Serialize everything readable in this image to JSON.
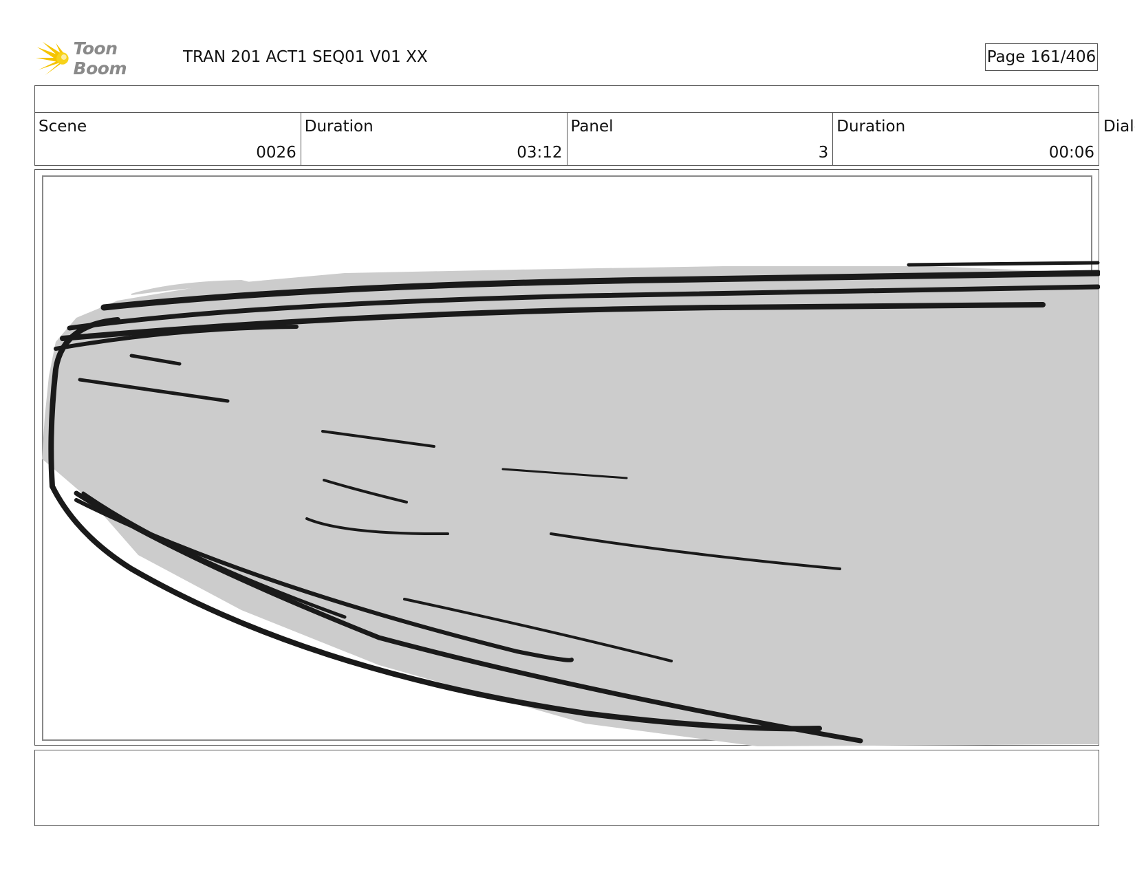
{
  "header": {
    "logo_text": "Toon Boom",
    "title": "TRAN 201 ACT1 SEQ01 V01 XX",
    "page": "Page 161/406"
  },
  "info": {
    "scene_label": "Scene",
    "scene_value": "0026",
    "scene_duration_label": "Duration",
    "scene_duration_value": "03:12",
    "panel_label": "Panel",
    "panel_value": "3",
    "panel_duration_label": "Duration",
    "panel_duration_value": "00:06",
    "dialog_label": "Dialo"
  },
  "colors": {
    "sketch_fill": "#cccccc",
    "sketch_stroke": "#1a1a1a",
    "logo_yellow": "#f5c400"
  }
}
